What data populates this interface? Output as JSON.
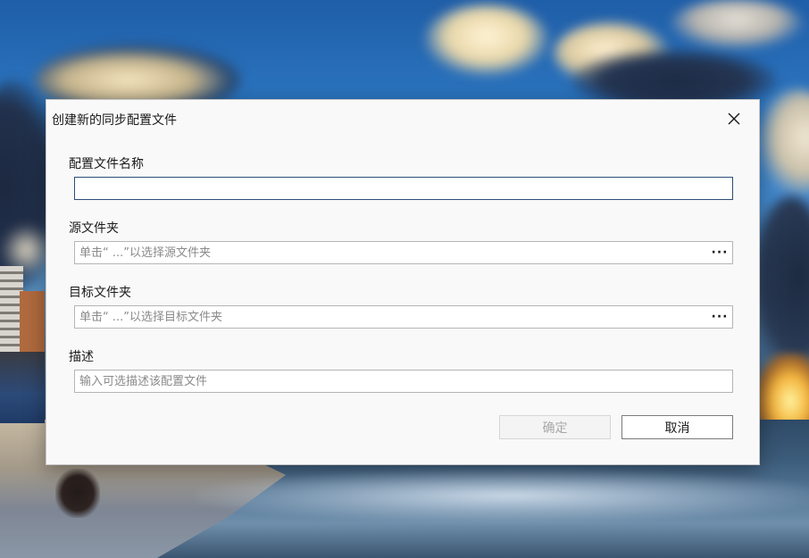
{
  "dialog": {
    "title": "创建新的同步配置文件",
    "close_icon": "close-icon"
  },
  "fields": {
    "profile_name": {
      "label": "配置文件名称",
      "value": "",
      "placeholder": ""
    },
    "source_folder": {
      "label": "源文件夹",
      "value": "",
      "placeholder": "单击“ ...”以选择源文件夹",
      "browse_label": "···"
    },
    "target_folder": {
      "label": "目标文件夹",
      "value": "",
      "placeholder": "单击“ ...”以选择目标文件夹",
      "browse_label": "···"
    },
    "description": {
      "label": "描述",
      "value": "",
      "placeholder": "输入可选描述该配置文件"
    }
  },
  "buttons": {
    "ok_label": "确定",
    "ok_enabled": false,
    "cancel_label": "取消"
  },
  "colors": {
    "focus_border": "#2b4f78",
    "disabled_text": "#a8a8a8"
  }
}
